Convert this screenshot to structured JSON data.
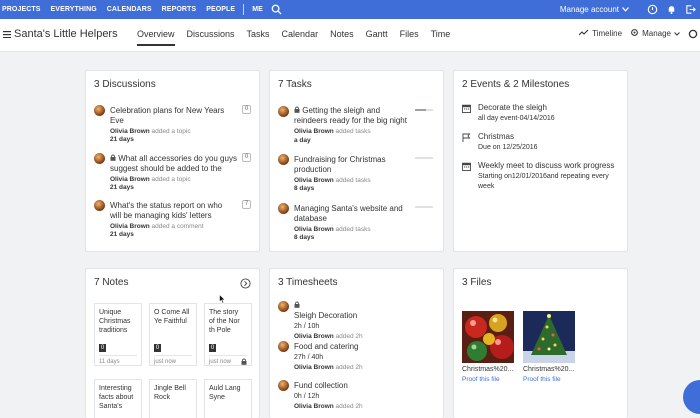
{
  "topbar": {
    "nav": [
      "PROJECTS",
      "EVERYTHING",
      "CALENDARS",
      "REPORTS",
      "PEOPLE",
      "ME"
    ],
    "manage_account": "Manage account",
    "accent": "#3f6ed8"
  },
  "subheader": {
    "project_title": "Santa's Little Helpers",
    "tabs": [
      "Overview",
      "Discussions",
      "Tasks",
      "Calendar",
      "Notes",
      "Gantt",
      "Files",
      "Time"
    ],
    "active_tab": "Overview",
    "timeline": "Timeline",
    "manage": "Manage"
  },
  "discussions": {
    "title": "3 Discussions",
    "items": [
      {
        "title1": "Celebration plans for New Years",
        "title2": "Eve",
        "author": "Olivia Brown",
        "action": "added a topic",
        "age": "21 days",
        "count": "0",
        "locked": false
      },
      {
        "title1": "What all accessories do you guys",
        "title2": "suggest should be added to the",
        "author": "Olivia Brown",
        "action": "added a topic",
        "age": "21 days",
        "count": "0",
        "locked": true
      },
      {
        "title1": "What's the status report on who",
        "title2": "will be managing kids' letters",
        "author": "Olivia Brown",
        "action": "added a comment",
        "age": "21 days",
        "count": "7",
        "locked": false
      }
    ]
  },
  "tasks": {
    "title": "7 Tasks",
    "items": [
      {
        "title1": "Getting the sleigh and",
        "title2": "reindeers ready for the big night",
        "author": "Olivia Brown",
        "action": "added tasks",
        "age": "a day",
        "locked": true,
        "progress": 0.6
      },
      {
        "title1": "Fundraising for Christmas",
        "title2": "production",
        "author": "Olivia Brown",
        "action": "added tasks",
        "age": "8 days",
        "locked": false,
        "progress": 0
      },
      {
        "title1": "Managing Santa's website and",
        "title2": "database",
        "author": "Olivia Brown",
        "action": "added tasks",
        "age": "8 days",
        "locked": false,
        "progress": 0
      }
    ]
  },
  "events": {
    "title": "2 Events & 2 Milestones",
    "items": [
      {
        "icon": "calendar-icon",
        "title": "Decorate the sleigh",
        "sub1": "all day event-04/14/2016",
        "sub2": "",
        "sub3": ""
      },
      {
        "icon": "flag-icon",
        "title": "Christmas",
        "sub1": "Due on 12/25/2016",
        "sub2": "",
        "sub3": ""
      },
      {
        "icon": "calendar-icon",
        "title": "Weekly meet to discuss work progress",
        "sub1": "Starting on12/01/2016and repeating every",
        "sub2": "week",
        "sub3": ""
      }
    ]
  },
  "notes": {
    "title": "7 Notes",
    "items": [
      {
        "text": [
          "Unique",
          "Christmas",
          "traditions"
        ],
        "count": "0",
        "footer": "11 days",
        "locked": false
      },
      {
        "text": [
          "O Come All",
          "Ye Faithful"
        ],
        "count": "0",
        "footer": "just now",
        "locked": false
      },
      {
        "text": [
          "The story",
          "of the Nor",
          "th Pole"
        ],
        "count": "0",
        "footer": "just now",
        "locked": true
      }
    ],
    "items_row2": [
      {
        "text": [
          "Interesting",
          "facts about",
          "Santa's"
        ]
      },
      {
        "text": [
          "Jingle Bell",
          "Rock"
        ]
      },
      {
        "text": [
          "Auld Lang",
          "Syne"
        ]
      }
    ]
  },
  "timesheets": {
    "title": "3 Timesheets",
    "items": [
      {
        "title": "Sleigh Decoration",
        "hours": "2h / 10h",
        "author": "Olivia Brown",
        "action": "added 2h",
        "locked": true
      },
      {
        "title": "Food and catering",
        "hours": "27h / 40h",
        "author": "Olivia Brown",
        "action": "added 2h",
        "locked": false
      },
      {
        "title": "Fund collection",
        "hours": "0h / 12h",
        "author": "Olivia Brown",
        "action": "added 2h",
        "locked": false
      }
    ]
  },
  "files": {
    "title": "3 Files",
    "items": [
      {
        "name": "Christmas%20...",
        "link": "Proof this file"
      },
      {
        "name": "Christmas%20...",
        "link": "Proof this file"
      }
    ]
  }
}
